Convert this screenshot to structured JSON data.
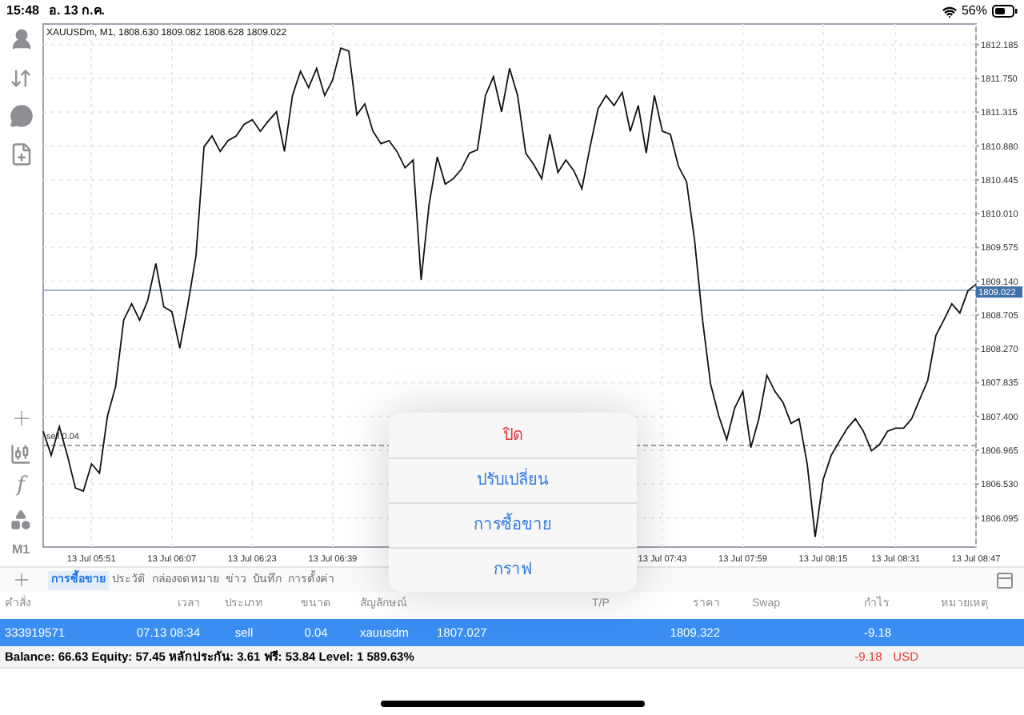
{
  "status_bar": {
    "time": "15:48",
    "date": "อ. 13 ก.ค.",
    "battery": "56%"
  },
  "left_toolbar": {
    "indicator_symbol": "f",
    "timeframe": "M1"
  },
  "chart": {
    "title": "XAUUSDm, M1, 1808.630 1809.082 1808.628 1809.022",
    "chart_data": {
      "type": "line",
      "ylim": [
        1805.72,
        1812.45
      ],
      "grid": true,
      "categories": [
        null,
        null,
        null,
        null,
        null,
        null,
        "13 Jul 05:51",
        null,
        null,
        null,
        null,
        null,
        null,
        null,
        null,
        null,
        "13 Jul 06:07",
        null,
        null,
        null,
        null,
        null,
        null,
        null,
        null,
        null,
        "13 Jul 06:23",
        null,
        null,
        null,
        null,
        null,
        null,
        null,
        null,
        null,
        "13 Jul 06:39",
        null,
        null,
        null,
        null,
        null,
        null,
        null,
        null,
        null,
        null,
        null,
        null,
        null,
        null,
        null,
        null,
        null,
        null,
        null,
        null,
        null,
        null,
        null,
        null,
        null,
        null,
        null,
        null,
        null,
        null,
        null,
        null,
        null,
        null,
        null,
        null,
        null,
        null,
        null,
        null,
        "13 Jul 07:43",
        null,
        null,
        null,
        null,
        null,
        null,
        null,
        null,
        null,
        "13 Jul 07:59",
        null,
        null,
        null,
        null,
        null,
        null,
        null,
        null,
        null,
        "13 Jul 08:15",
        null,
        null,
        null,
        null,
        null,
        null,
        null,
        null,
        "13 Jul 08:31",
        null,
        null,
        null,
        null,
        null,
        null,
        null,
        null,
        null,
        "13 Jul 08:47"
      ],
      "series": [
        {
          "color": "#111111",
          "values": [
            1807.21,
            1806.9,
            1807.27,
            1806.9,
            1806.48,
            1806.44,
            1806.79,
            1806.67,
            1807.41,
            1807.78,
            1808.64,
            1808.85,
            1808.64,
            1808.89,
            1809.37,
            1808.81,
            1808.75,
            1808.28,
            1808.85,
            1809.47,
            1810.87,
            1811.01,
            1810.81,
            1810.95,
            1811.01,
            1811.16,
            1811.22,
            1811.07,
            1811.2,
            1811.32,
            1810.81,
            1811.53,
            1811.84,
            1811.63,
            1811.88,
            1811.53,
            1811.73,
            1812.14,
            1812.1,
            1811.28,
            1811.42,
            1811.07,
            1810.91,
            1810.95,
            1810.81,
            1810.6,
            1810.7,
            1809.16,
            1810.13,
            1810.74,
            1810.39,
            1810.46,
            1810.58,
            1810.79,
            1810.83,
            1811.53,
            1811.77,
            1811.32,
            1811.88,
            1811.53,
            1810.79,
            1810.64,
            1810.46,
            1811.03,
            1810.54,
            1810.7,
            1810.56,
            1810.33,
            1810.87,
            1811.36,
            1811.53,
            1811.4,
            1811.57,
            1811.07,
            1811.4,
            1810.79,
            1811.53,
            1811.07,
            1811.03,
            1810.62,
            1810.42,
            1809.67,
            1808.64,
            1807.82,
            1807.41,
            1807.1,
            1807.51,
            1807.72,
            1807.0,
            1807.37,
            1807.93,
            1807.72,
            1807.58,
            1807.31,
            1807.37,
            1806.79,
            1805.85,
            1806.59,
            1806.9,
            1807.08,
            1807.25,
            1807.37,
            1807.21,
            1806.96,
            1807.04,
            1807.21,
            1807.25,
            1807.25,
            1807.37,
            1807.62,
            1807.86,
            1808.44,
            1808.64,
            1808.85,
            1808.73,
            1809.02,
            1809.1
          ]
        }
      ],
      "yticks": [
        {
          "value": 1812.185,
          "label": "1812.185"
        },
        {
          "value": 1811.75,
          "label": "1811.750"
        },
        {
          "value": 1811.315,
          "label": "1811.315"
        },
        {
          "value": 1810.88,
          "label": "1810.880"
        },
        {
          "value": 1810.445,
          "label": "1810.445"
        },
        {
          "value": 1810.01,
          "label": "1810.010"
        },
        {
          "value": 1809.575,
          "label": "1809.575"
        },
        {
          "value": 1809.14,
          "label": "1809.140"
        },
        {
          "value": 1808.705,
          "label": "1808.705"
        },
        {
          "value": 1808.27,
          "label": "1808.270"
        },
        {
          "value": 1807.835,
          "label": "1807.835"
        },
        {
          "value": 1807.4,
          "label": "1807.400"
        },
        {
          "value": 1806.965,
          "label": "1806.965"
        },
        {
          "value": 1806.53,
          "label": "1806.530"
        },
        {
          "value": 1806.095,
          "label": "1806.095"
        }
      ],
      "ref_lines": [
        {
          "axis": "y",
          "value": 1809.022,
          "label": "1809.022",
          "color": "#9fb3c8"
        },
        {
          "axis": "y",
          "value": 1807.027,
          "label": "sell 0.04",
          "color": "#9ca3af"
        }
      ]
    }
  },
  "tabs": [
    {
      "label": "การซื้อขาย",
      "selected": true
    },
    {
      "label": "ประวัติ",
      "selected": false
    },
    {
      "label": "กล่องจดหมาย",
      "selected": false
    },
    {
      "label": "ข่าว",
      "selected": false
    },
    {
      "label": "บันทึก",
      "selected": false
    },
    {
      "label": "การตั้งค่า",
      "selected": false
    }
  ],
  "table": {
    "columns": [
      {
        "label": "คำสั่ง"
      },
      {
        "label": "เวลา"
      },
      {
        "label": "ประเภท"
      },
      {
        "label": "ขนาด"
      },
      {
        "label": "สัญลักษณ์"
      },
      {},
      {},
      {
        "label": "T/P"
      },
      {
        "label": "ราคา"
      },
      {
        "label": "Swap"
      },
      {
        "label": "กำไร"
      },
      {
        "label": "หมายเหตุ"
      }
    ],
    "rows": [
      {
        "selected": true,
        "cells": [
          {
            "text": "333919571"
          },
          {
            "text": "07.13 08:34"
          },
          {
            "text": "sell"
          },
          {
            "text": "0.04"
          },
          {
            "text": "xauusdm"
          },
          {
            "text": "1807.027"
          },
          {},
          {},
          {
            "text": "1809.322"
          },
          {},
          {
            "text": "-9.18"
          },
          {}
        ]
      }
    ]
  },
  "summary": {
    "text": "Balance: 66.63 Equity: 57.45 หลักประกัน: 3.61 ฟรี: 53.84 Level: 1 589.63%",
    "profit": "-9.18",
    "currency": "USD"
  },
  "popover": {
    "items": [
      {
        "label": "ปิด",
        "kind": "destructive"
      },
      {
        "label": "ปรับเปลี่ยน",
        "kind": "action"
      },
      {
        "label": "การซื้อขาย",
        "kind": "action"
      },
      {
        "label": "กราฟ",
        "kind": "action"
      }
    ]
  }
}
